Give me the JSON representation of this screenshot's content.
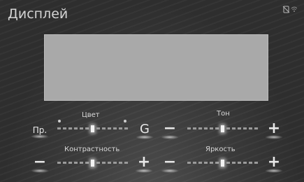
{
  "title": "Дисплей",
  "status_icons": [
    "phone-muted-icon",
    "wifi-icon"
  ],
  "preview_area": {
    "label": ""
  },
  "color": {
    "label": "Цвет",
    "reset_button": "Пр.",
    "g_button": "G",
    "level": 0.5
  },
  "tone": {
    "label": "Тон",
    "minus": "−",
    "plus": "+",
    "level": 0.5
  },
  "contrast": {
    "label": "Контрастность",
    "minus": "−",
    "plus": "+",
    "level": 0.5
  },
  "brightness": {
    "label": "Яркость",
    "minus": "−",
    "plus": "+",
    "level": 0.5
  },
  "colors": {
    "background": "#3a3a3a",
    "preview": "#a9a9a9",
    "text": "#d8d8d8"
  }
}
